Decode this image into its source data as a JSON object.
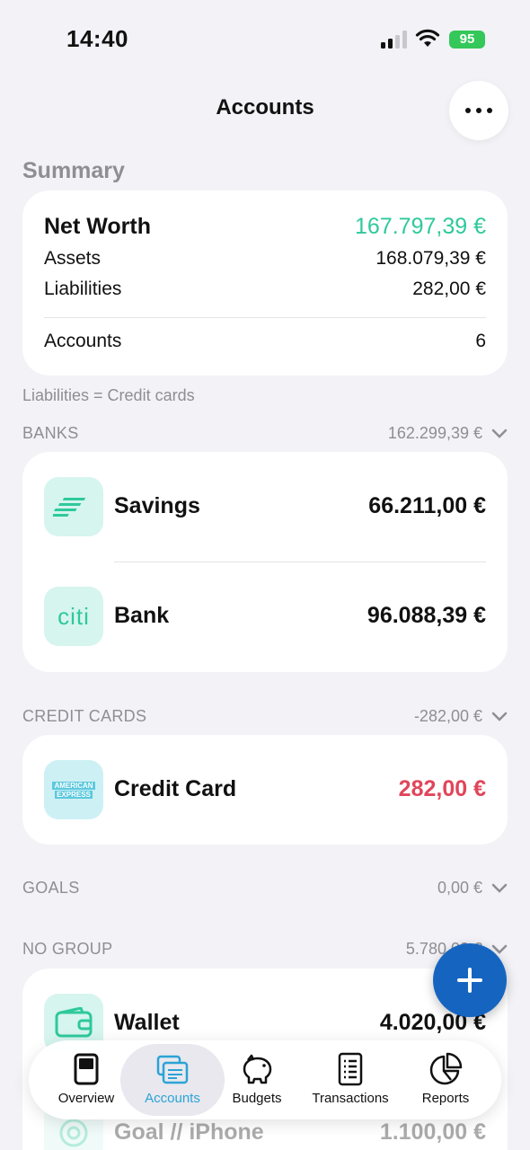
{
  "status_bar": {
    "time": "14:40",
    "battery": "95"
  },
  "header": {
    "title": "Accounts"
  },
  "summary": {
    "heading": "Summary",
    "net_worth_label": "Net Worth",
    "net_worth_value": "167.797,39 €",
    "assets_label": "Assets",
    "assets_value": "168.079,39 €",
    "liabilities_label": "Liabilities",
    "liabilities_value": "282,00 €",
    "accounts_label": "Accounts",
    "accounts_value": "6",
    "footnote": "Liabilities = Credit cards"
  },
  "groups": {
    "banks": {
      "label": "BANKS",
      "total": "162.299,39 €",
      "accounts": [
        {
          "name": "Savings",
          "value": "66.211,00 €",
          "icon": "bank-of-america-logo-icon"
        },
        {
          "name": "Bank",
          "value": "96.088,39 €",
          "icon": "citi-logo-icon",
          "logo_text": "citi"
        }
      ]
    },
    "credit_cards": {
      "label": "CREDIT CARDS",
      "total": "-282,00 €",
      "accounts": [
        {
          "name": "Credit Card",
          "value": "282,00 €",
          "icon": "american-express-logo-icon",
          "logo_text_1": "AMERICAN",
          "logo_text_2": "EXPRESS"
        }
      ]
    },
    "goals": {
      "label": "GOALS",
      "total": "0,00 €"
    },
    "no_group": {
      "label": "NO GROUP",
      "total": "5.780,00 €",
      "accounts": [
        {
          "name": "Wallet",
          "value": "4.020,00 €",
          "icon": "wallet-icon"
        },
        {
          "name": "Goal // iPhone",
          "value": "1.100,00 €",
          "icon": "goal-icon"
        }
      ]
    }
  },
  "tabs": [
    {
      "label": "Overview",
      "icon": "overview-icon"
    },
    {
      "label": "Accounts",
      "icon": "accounts-icon",
      "active": true
    },
    {
      "label": "Budgets",
      "icon": "piggy-bank-icon"
    },
    {
      "label": "Transactions",
      "icon": "transactions-icon"
    },
    {
      "label": "Reports",
      "icon": "pie-chart-icon"
    }
  ],
  "colors": {
    "positive": "#2ec99b",
    "negative": "#e0465a",
    "accent": "#2aa3d6",
    "fab": "#1565c0",
    "icon_bg": "#d6f5ee"
  }
}
